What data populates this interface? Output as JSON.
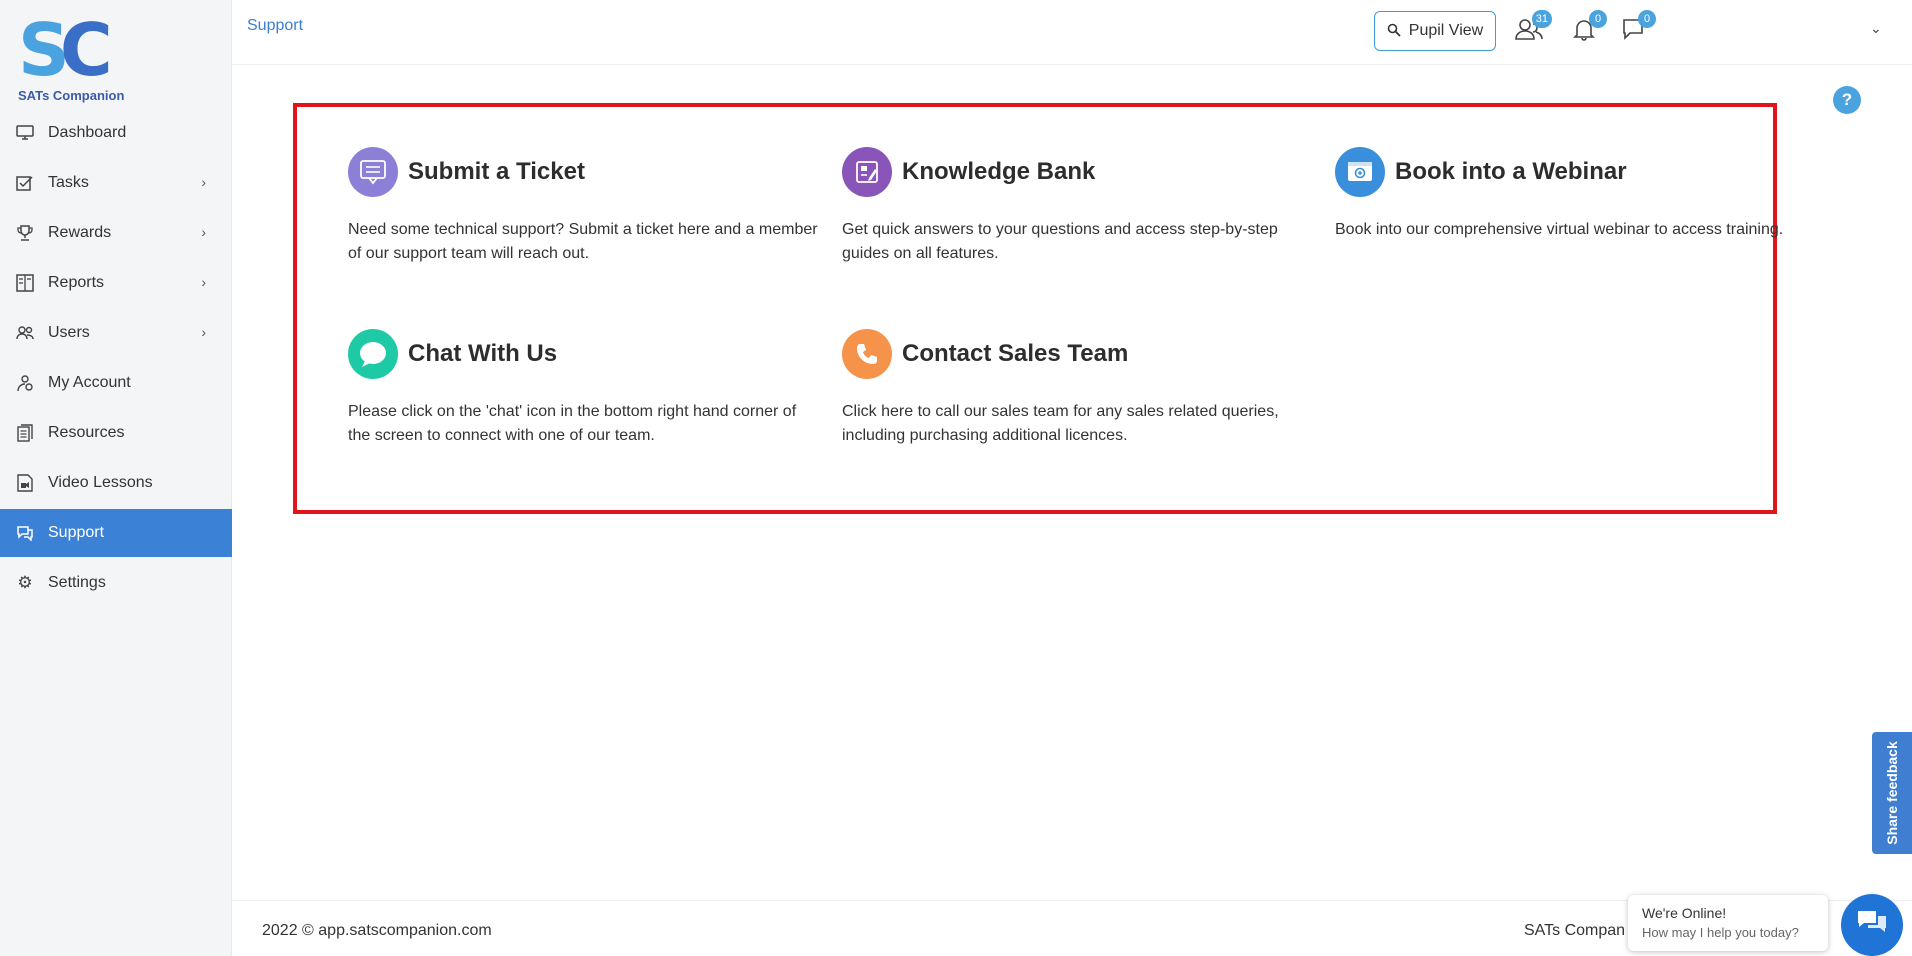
{
  "logo": {
    "letters_s": "S",
    "letters_c": "C",
    "text": "SATs Companion"
  },
  "sidebar": {
    "items": [
      {
        "label": "Dashboard",
        "icon": "monitor-icon",
        "chevron": false,
        "active": false
      },
      {
        "label": "Tasks",
        "icon": "tasks-icon",
        "chevron": true,
        "active": false
      },
      {
        "label": "Rewards",
        "icon": "trophy-icon",
        "chevron": true,
        "active": false
      },
      {
        "label": "Reports",
        "icon": "reports-icon",
        "chevron": true,
        "active": false
      },
      {
        "label": "Users",
        "icon": "users-icon",
        "chevron": true,
        "active": false
      },
      {
        "label": "My Account",
        "icon": "account-icon",
        "chevron": false,
        "active": false
      },
      {
        "label": "Resources",
        "icon": "resources-icon",
        "chevron": false,
        "active": false
      },
      {
        "label": "Video Lessons",
        "icon": "video-icon",
        "chevron": false,
        "active": false
      },
      {
        "label": "Support",
        "icon": "chat-bubbles-icon",
        "chevron": false,
        "active": true
      },
      {
        "label": "Settings",
        "icon": "gear-icon",
        "chevron": false,
        "active": false
      }
    ]
  },
  "header": {
    "breadcrumb": "Support",
    "pupil_view_label": "Pupil View",
    "users_badge": "31",
    "notifications_badge": "0",
    "messages_badge": "0"
  },
  "help_label": "?",
  "cards": [
    {
      "title": "Submit a Ticket",
      "description": "Need some technical support? Submit a ticket here and a member of our support team will reach out.",
      "icon": "ticket-icon",
      "color": "#8b7fd8"
    },
    {
      "title": "Knowledge Bank",
      "description": "Get quick answers to your questions and access step-by-step guides on all features.",
      "icon": "knowledge-icon",
      "color": "#8a55b8"
    },
    {
      "title": "Book into a Webinar",
      "description": "Book into our comprehensive virtual webinar to access training.",
      "icon": "webinar-icon",
      "color": "#3a8fdd"
    },
    {
      "title": "Chat With Us",
      "description": "Please click on the 'chat' icon in the bottom right hand corner of the screen to connect with one of our team.",
      "icon": "chat-icon",
      "color": "#1ec9a6"
    },
    {
      "title": "Contact Sales Team",
      "description": "Click here to call our sales team for any sales related queries, including purchasing additional licences.",
      "icon": "phone-icon",
      "color": "#f5934a"
    }
  ],
  "footer": {
    "left": "2022 © app.satscompanion.com",
    "right": "SATs Compan"
  },
  "share_feedback": "Share feedback",
  "chat_widget": {
    "line1": "We're Online!",
    "line2": "How may I help you today?"
  },
  "colors": {
    "accent": "#3b82d6",
    "panel_border": "#e2141b",
    "badge": "#4aa3df"
  }
}
